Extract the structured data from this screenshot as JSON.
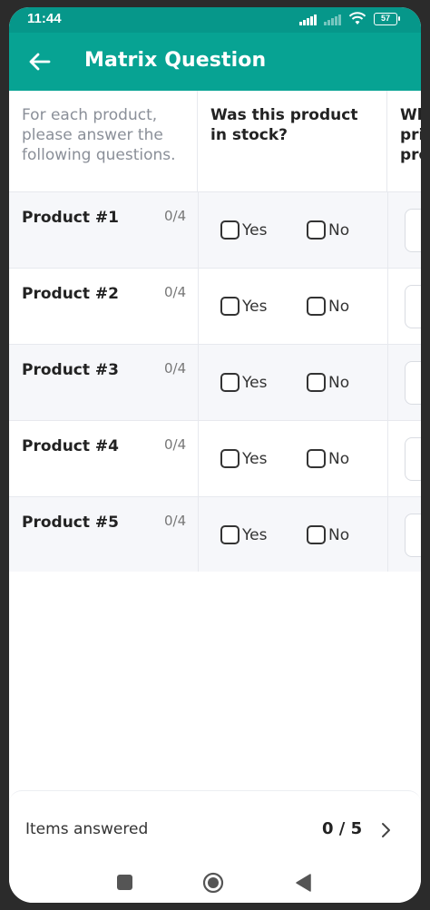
{
  "status_bar": {
    "time": "11:44",
    "battery": "57"
  },
  "app_bar": {
    "title": "Matrix Question"
  },
  "matrix": {
    "headers": [
      "For each product, please answer the following questions.",
      "Was this product in stock?",
      "What was the price of this product?"
    ],
    "rows": [
      {
        "label": "Product #1",
        "progress": "0/4"
      },
      {
        "label": "Product #2",
        "progress": "0/4"
      },
      {
        "label": "Product #3",
        "progress": "0/4"
      },
      {
        "label": "Product #4",
        "progress": "0/4"
      },
      {
        "label": "Product #5",
        "progress": "0/4"
      }
    ],
    "options": {
      "yes": "Yes",
      "no": "No"
    }
  },
  "footer": {
    "label": "Items answered",
    "count": "0 / 5"
  },
  "colors": {
    "status_bar": "#06978a",
    "app_bar": "#07a393",
    "alt_row": "#f6f7fa"
  }
}
